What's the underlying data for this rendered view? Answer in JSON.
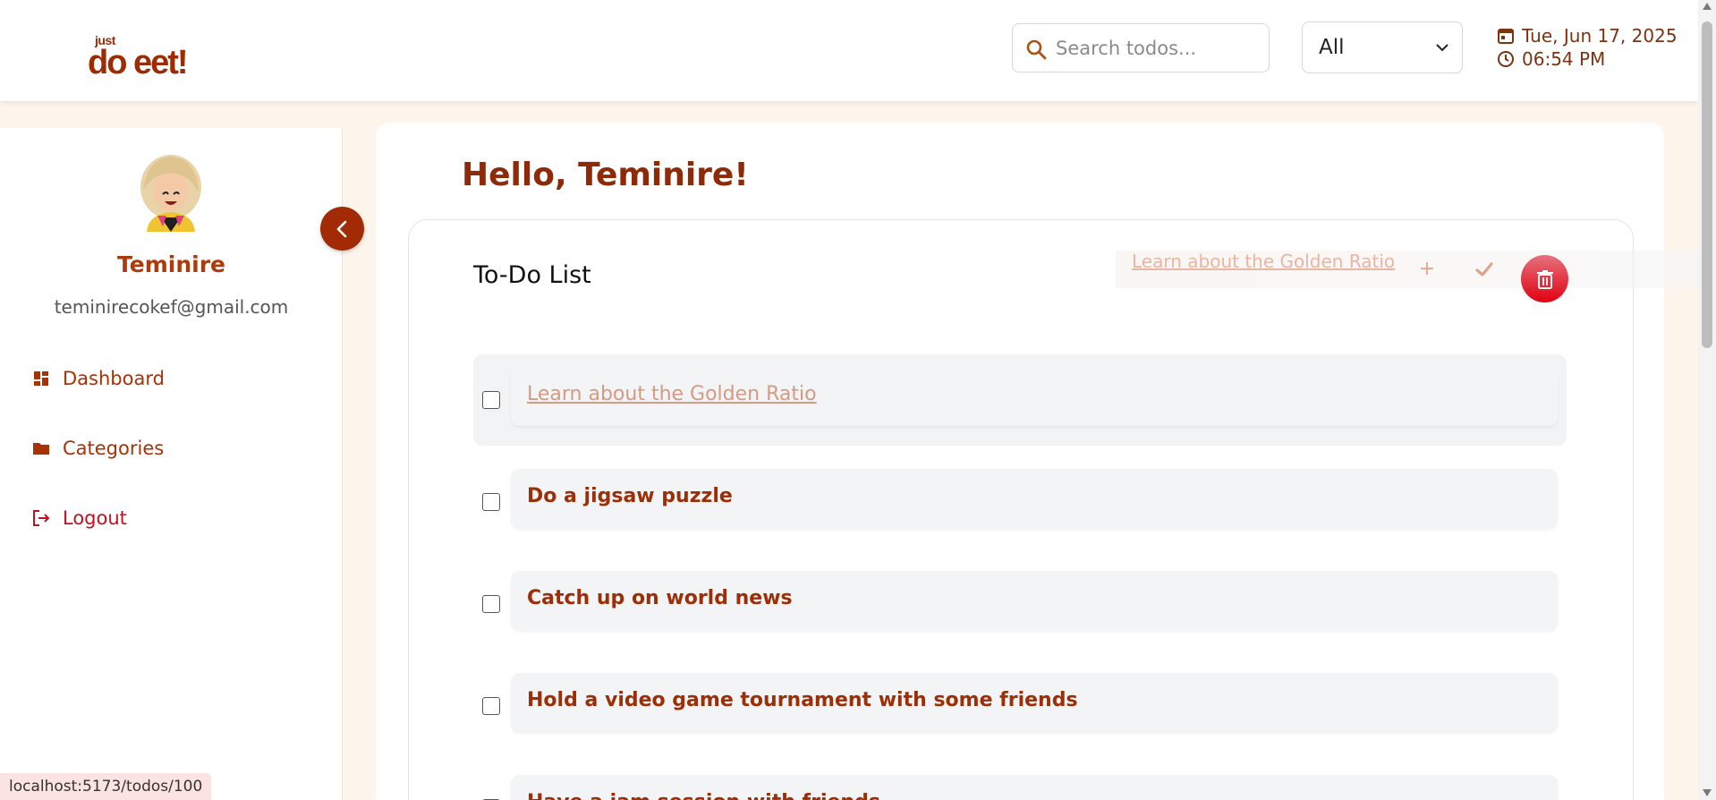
{
  "header": {
    "logo_small": "just",
    "logo_big": "do eet!",
    "search_placeholder": "Search todos...",
    "filter_selected": "All",
    "date": "Tue, Jun 17, 2025",
    "time": "06:54 PM"
  },
  "sidebar": {
    "user_name": "Teminire",
    "user_email": "teminirecokef@gmail.com",
    "items": [
      {
        "label": "Dashboard",
        "icon": "dashboard-icon"
      },
      {
        "label": "Categories",
        "icon": "folder-icon"
      },
      {
        "label": "Logout",
        "icon": "logout-icon"
      }
    ]
  },
  "main": {
    "greeting": "Hello, Teminire!",
    "list_title": "To-Do List",
    "drag_preview": "Learn about the Golden Ratio",
    "todos": [
      {
        "text": "Learn about the Golden Ratio",
        "done": false
      },
      {
        "text": "Do a jigsaw puzzle",
        "done": false
      },
      {
        "text": "Catch up on world news",
        "done": false
      },
      {
        "text": "Hold a video game tournament with some friends",
        "done": false
      },
      {
        "text": "Have a jam session with friends",
        "done": false
      }
    ]
  },
  "status_bar": {
    "url": "localhost:5173/todos/100"
  },
  "colors": {
    "accent": "#a22a04",
    "danger": "#e10010",
    "background": "#fdf4ec"
  }
}
